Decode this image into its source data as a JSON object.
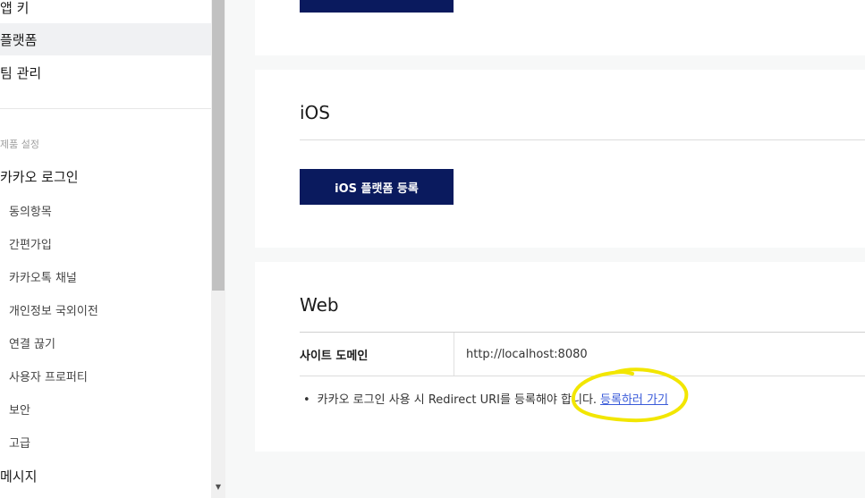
{
  "sidebar": {
    "items_top": [
      {
        "label": "앱 키",
        "active": false
      },
      {
        "label": "플랫폼",
        "active": true
      },
      {
        "label": "팀 관리",
        "active": false
      }
    ],
    "section_label": "제품 설정",
    "kakao_login": "카카오 로그인",
    "sub_items": [
      "동의항목",
      "간편가입",
      "카카오톡 채널",
      "개인정보 국외이전",
      "연결 끊기",
      "사용자 프로퍼티",
      "보안",
      "고급"
    ],
    "message": "메시지"
  },
  "main": {
    "ios": {
      "title": "iOS",
      "button": "iOS 플랫폼 등록"
    },
    "web": {
      "title": "Web",
      "domain_label": "사이트 도메인",
      "domain_value": "http://localhost:8080",
      "note_bullet": "•",
      "note_text": "카카오 로그인 사용 시 Redirect URI를 등록해야 합니다.",
      "note_link": "등록하러 가기"
    }
  },
  "colors": {
    "button_bg": "#0a1a5e",
    "link": "#3a5bd9",
    "highlight": "#f2e600"
  }
}
